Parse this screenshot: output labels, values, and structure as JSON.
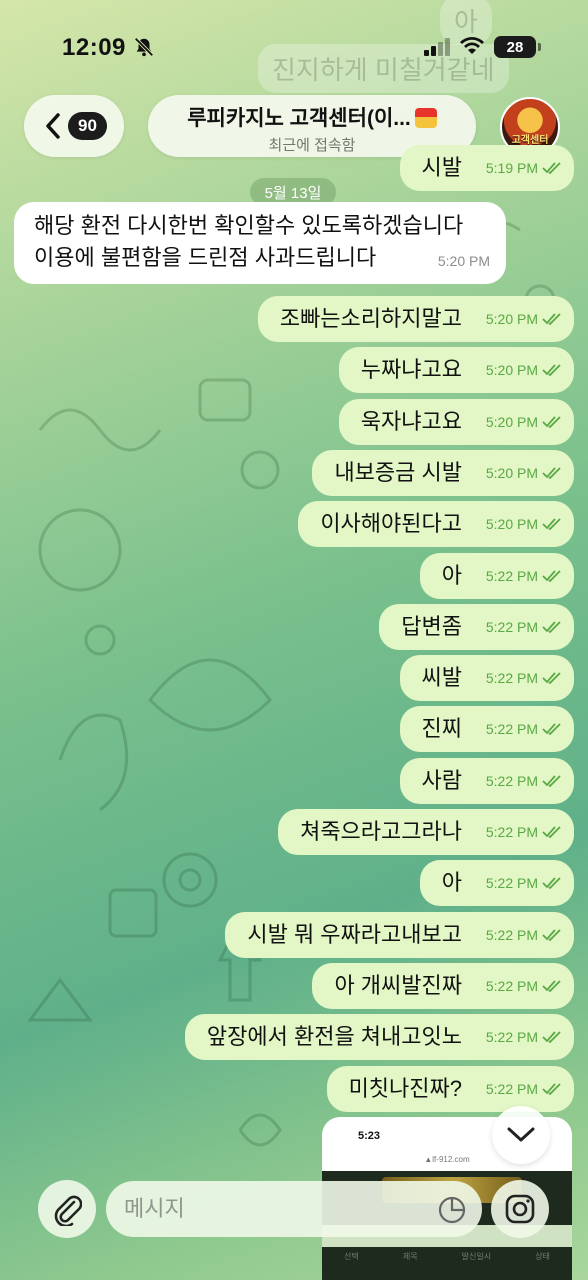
{
  "status_bar": {
    "time": "12:09",
    "battery": "28"
  },
  "background_ghost": [
    "아",
    "진지하게 미칠거같네"
  ],
  "header": {
    "back_badge": "90",
    "title": "루피카지노 고객센터(이...",
    "subtitle": "최근에 접속함",
    "avatar_label": "고객센터"
  },
  "date_chip": "5월 13일",
  "top_partial_message": {
    "text": "시발",
    "time": "5:19 PM"
  },
  "incoming_message": {
    "lines": [
      "해당 환전 다시한번 확인할수 있도록하겠습니다",
      "이용에 불편함을 드린점 사과드립니다"
    ],
    "time": "5:20 PM"
  },
  "outgoing_messages": [
    {
      "text": "조빠는소리하지말고",
      "time": "5:20 PM"
    },
    {
      "text": "누짜냐고요",
      "time": "5:20 PM"
    },
    {
      "text": "욱자냐고요",
      "time": "5:20 PM"
    },
    {
      "text": "내보증금 시발",
      "time": "5:20 PM"
    },
    {
      "text": "이사해야된다고",
      "time": "5:20 PM"
    },
    {
      "text": "아",
      "time": "5:22 PM"
    },
    {
      "text": "답변좀",
      "time": "5:22 PM"
    },
    {
      "text": "씨발",
      "time": "5:22 PM"
    },
    {
      "text": "진찌",
      "time": "5:22 PM"
    },
    {
      "text": "사람",
      "time": "5:22 PM"
    },
    {
      "text": "쳐죽으라고그라나",
      "time": "5:22 PM"
    },
    {
      "text": "아",
      "time": "5:22 PM"
    },
    {
      "text": "시발 뭐 우짜라고내보고",
      "time": "5:22 PM"
    },
    {
      "text": "아 개씨발진짜",
      "time": "5:22 PM"
    },
    {
      "text": "앞장에서 환전을 쳐내고잇노",
      "time": "5:22 PM"
    },
    {
      "text": "미칫나진짜?",
      "time": "5:22 PM"
    }
  ],
  "image_preview": {
    "time": "5:23",
    "url": "▲lf-912.com",
    "columns": [
      "선택",
      "제목",
      "발신일시",
      "상태"
    ]
  },
  "input": {
    "placeholder": "메시지"
  },
  "colors": {
    "outgoing_bubble": "#e2f7c5",
    "incoming_bubble": "#ffffff",
    "read_check": "#5aa845"
  }
}
